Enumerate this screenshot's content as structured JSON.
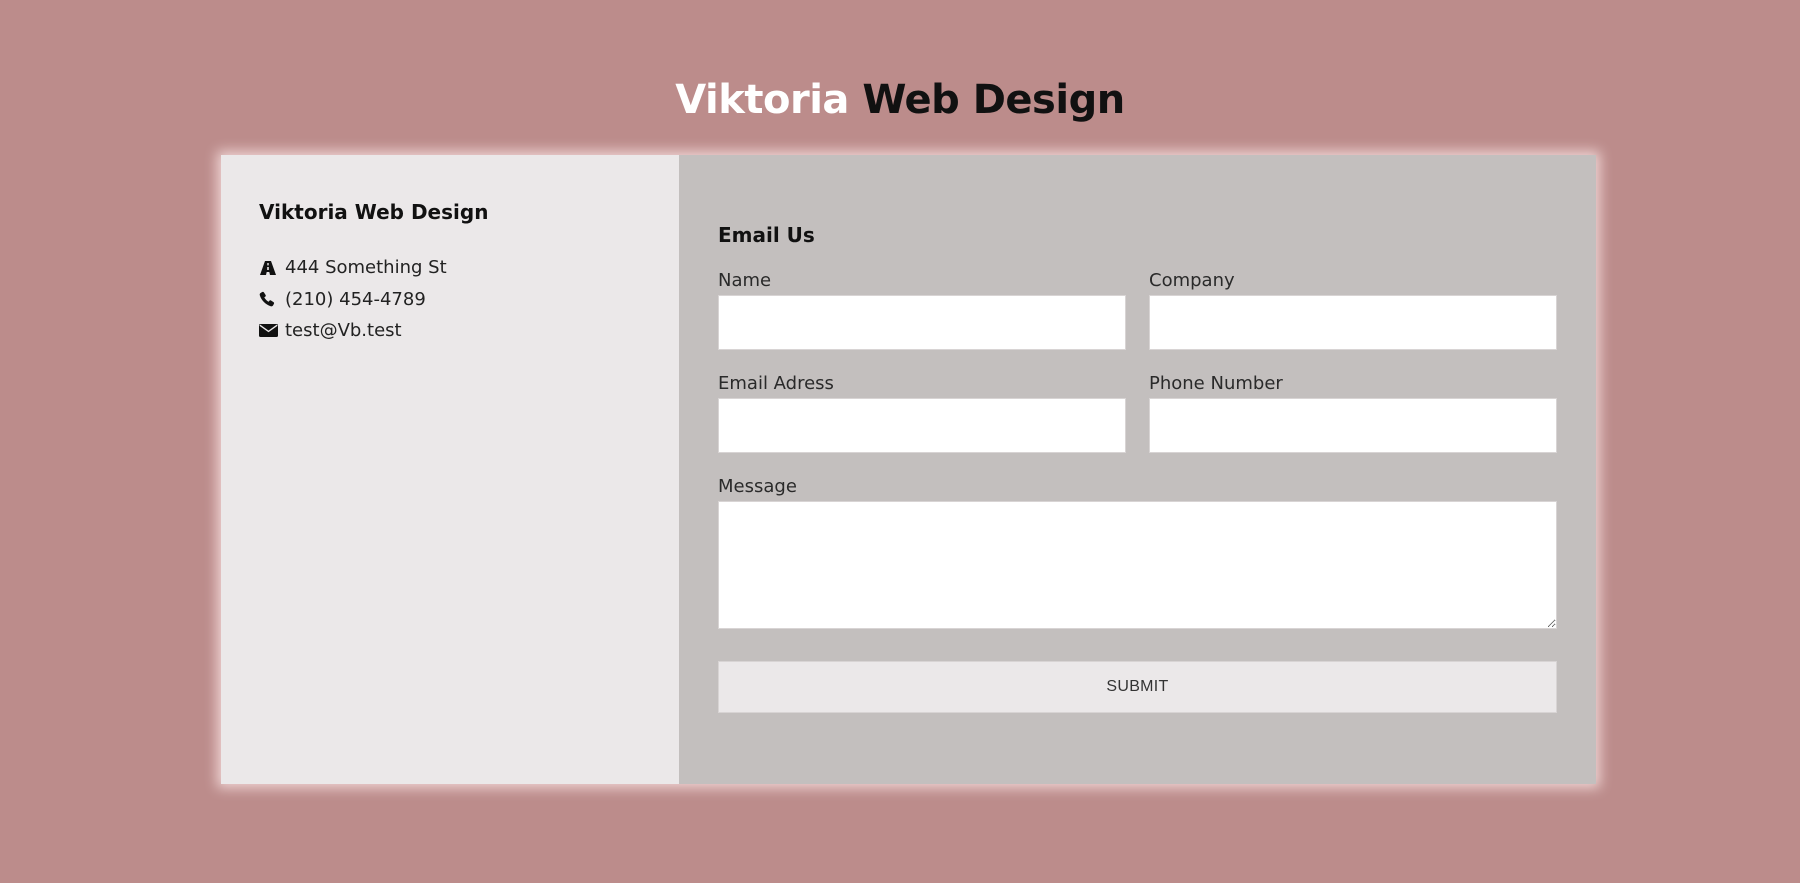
{
  "header": {
    "title_part1": "Viktoria",
    "title_part2": "Web Design"
  },
  "contact_info": {
    "company_name": "Viktoria Web Design",
    "items": [
      {
        "icon": "road-icon",
        "text": "444 Something St"
      },
      {
        "icon": "phone-icon",
        "text": "(210) 454-4789"
      },
      {
        "icon": "envelope-icon",
        "text": "test@Vb.test"
      }
    ]
  },
  "form": {
    "heading": "Email Us",
    "fields": {
      "name": {
        "label": "Name",
        "value": ""
      },
      "company": {
        "label": "Company",
        "value": ""
      },
      "email": {
        "label": "Email Adress",
        "value": ""
      },
      "phone": {
        "label": "Phone Number",
        "value": ""
      },
      "message": {
        "label": "Message",
        "value": ""
      }
    },
    "submit_label": "SUBMIT"
  },
  "colors": {
    "background": "#bc8c8b",
    "info_panel": "#ebe8e9",
    "form_panel": "#c3bfbe",
    "title_accent": "#ffffff",
    "title_dark": "#111111"
  }
}
